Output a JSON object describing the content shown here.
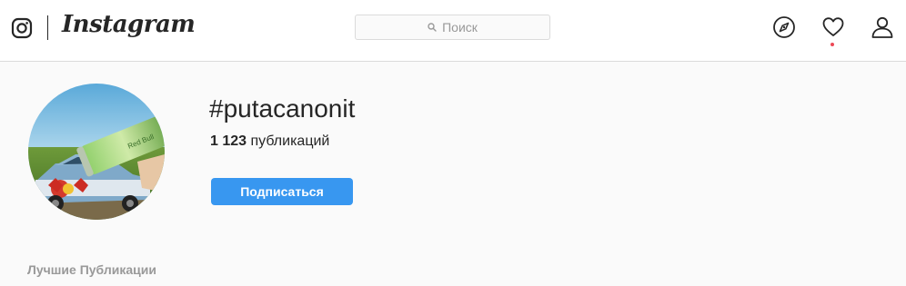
{
  "header": {
    "app_name": "Instagram",
    "search": {
      "placeholder": "Поиск"
    },
    "icons": [
      "instagram-glyph-icon",
      "compass-icon",
      "heart-icon",
      "profile-icon"
    ],
    "notification_dot_color": "#ed4956"
  },
  "profile": {
    "hashtag": "#putacanonit",
    "post_count": "1 123",
    "post_count_label": "публикаций",
    "follow_label": "Подписаться",
    "accent_color": "#3897f0"
  },
  "content": {
    "section_title": "Лучшие Публикации"
  }
}
